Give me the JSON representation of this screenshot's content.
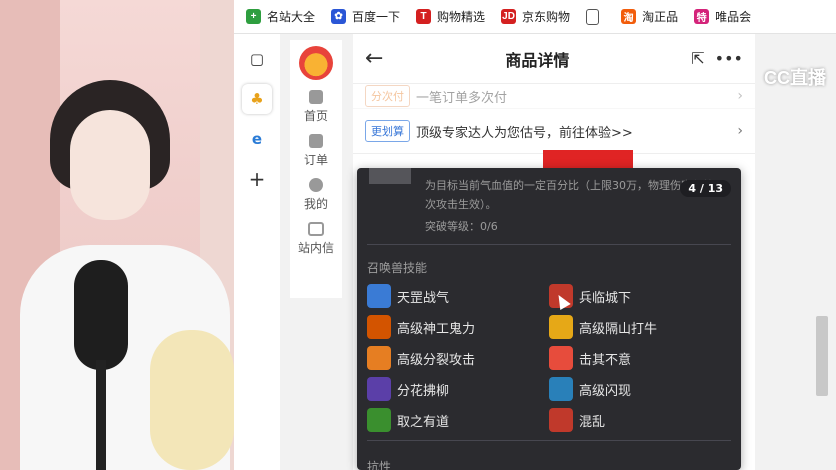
{
  "bookmarks": [
    {
      "label": "名站大全",
      "icon": "star-icon",
      "color": "#2e9e3f"
    },
    {
      "label": "百度一下",
      "icon": "paw-icon",
      "color": "#2a56d6"
    },
    {
      "label": "购物精选",
      "icon": "t-icon",
      "color": "#d42020"
    },
    {
      "label": "京东购物",
      "icon": "jd-icon",
      "color": "#d42020"
    },
    {
      "label": "",
      "icon": "document-icon",
      "color": "#555555"
    },
    {
      "label": "淘正品",
      "icon": "taobao-icon",
      "color": "#f25d0c"
    },
    {
      "label": "唯品会",
      "icon": "vip-icon",
      "color": "#d4237a"
    }
  ],
  "left_nav": {
    "home": "首页",
    "orders": "订单",
    "mine": "我的",
    "messages": "站内信"
  },
  "header": {
    "title": "商品详情",
    "back": "←",
    "share": "⇱",
    "more": "•••"
  },
  "rows": [
    {
      "tag": "分次付",
      "text": "一笔订单多次付"
    },
    {
      "tag": "更划算",
      "text": "顶级专家达人为您估号，前往体验>>"
    }
  ],
  "watermark": "CC直播",
  "tooltip": {
    "description": "为目标当前气血值的一定百分比（上限30万，物理伤害仅第一次攻击生效）。",
    "breakthrough": "突破等级：0/6",
    "pager": "4 / 13",
    "section_title": "召唤兽技能",
    "skills": [
      {
        "name": "天罡战气",
        "color": "#3a7bd5"
      },
      {
        "name": "兵临城下",
        "color": "#c0392b"
      },
      {
        "name": "高级神工鬼力",
        "color": "#d35400"
      },
      {
        "name": "高级隔山打牛",
        "color": "#e6a817"
      },
      {
        "name": "高级分裂攻击",
        "color": "#e67e22"
      },
      {
        "name": "击其不意",
        "color": "#e74c3c"
      },
      {
        "name": "分花拂柳",
        "color": "#5b3fa8"
      },
      {
        "name": "高级闪现",
        "color": "#2980b9"
      },
      {
        "name": "取之有道",
        "color": "#3a8f2e"
      },
      {
        "name": "混乱",
        "color": "#c0392b"
      }
    ],
    "next_section": "抗性"
  }
}
